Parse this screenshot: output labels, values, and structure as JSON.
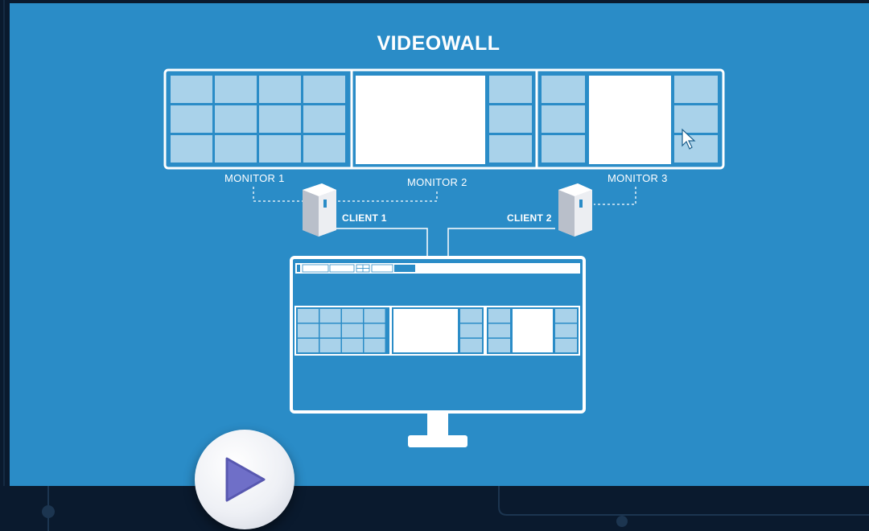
{
  "diagram": {
    "title": "VIDEOWALL",
    "monitors": [
      {
        "label": "MONITOR 1"
      },
      {
        "label": "MONITOR 2"
      },
      {
        "label": "MONITOR 3"
      }
    ],
    "clients": [
      {
        "label": "CLIENT 1"
      },
      {
        "label": "CLIENT 2"
      }
    ]
  },
  "controls": {
    "play_icon": "play-icon"
  },
  "colors": {
    "background": "#2a8cc7",
    "tile": "#a9d2ea",
    "tile_light": "#c2e0f1",
    "frame": "#ffffff",
    "outer": "#0a1a2e"
  }
}
